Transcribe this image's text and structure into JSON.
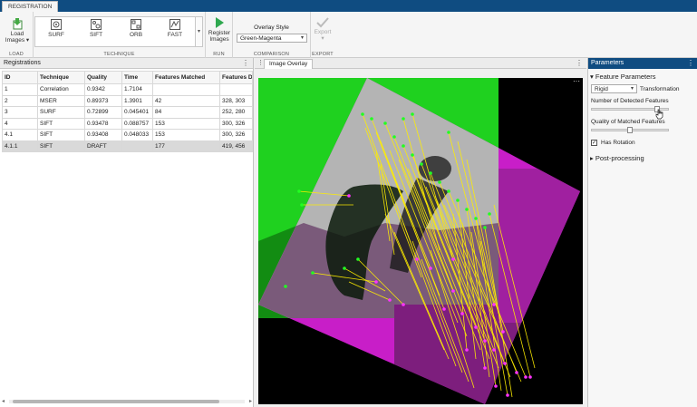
{
  "app": {
    "tab_label": "REGISTRATION"
  },
  "ribbon": {
    "load": {
      "button_line1": "Load",
      "button_line2": "Images",
      "section_label": "LOAD"
    },
    "technique": {
      "section_label": "TECHNIQUE",
      "items": [
        {
          "label": "SURF"
        },
        {
          "label": "SIFT"
        },
        {
          "label": "ORB"
        },
        {
          "label": "FAST"
        }
      ]
    },
    "run": {
      "button_line1": "Register",
      "button_line2": "Images",
      "section_label": "RUN"
    },
    "comparison": {
      "overlay_label": "Overlay Style",
      "overlay_value": "Green-Magenta",
      "section_label": "COMPARISON"
    },
    "export": {
      "button_label": "Export",
      "section_label": "EXPORT"
    }
  },
  "registrations": {
    "title": "Registrations",
    "columns": [
      "ID",
      "Technique",
      "Quality",
      "Time",
      "Features Matched",
      "Features Det"
    ],
    "rows": [
      [
        "1",
        "Correlation",
        "0.9342",
        "1.7104",
        "",
        ""
      ],
      [
        "2",
        "MSER",
        "0.89373",
        "1.3901",
        "42",
        "328, 303"
      ],
      [
        "3",
        "SURF",
        "0.72899",
        "0.045401",
        "84",
        "252, 280"
      ],
      [
        "4",
        "SIFT",
        "0.93478",
        "0.088757",
        "153",
        "300, 326"
      ],
      [
        "4.1",
        "SIFT",
        "0.93408",
        "0.048033",
        "153",
        "300, 326"
      ],
      [
        "4.1.1",
        "SIFT",
        "DRAFT",
        "",
        "177",
        "419, 456"
      ]
    ]
  },
  "document": {
    "tab_label": "Image Overlay"
  },
  "parameters": {
    "title": "Parameters",
    "feature_section": "Feature Parameters",
    "transformation_value": "Rigid",
    "transformation_label": "Transformation",
    "detected_label": "Number of Detected Features",
    "detected_level": 0.88,
    "quality_label": "Quality of Matched Features",
    "quality_level": 0.5,
    "rotation_label": "Has Rotation",
    "rotation_checked": true,
    "post_section": "Post-processing"
  },
  "colors": {
    "accent": "#0f4c81",
    "overlay_green": "#22dd22",
    "overlay_magenta": "#dd22dd",
    "match_line": "#ffee00"
  }
}
